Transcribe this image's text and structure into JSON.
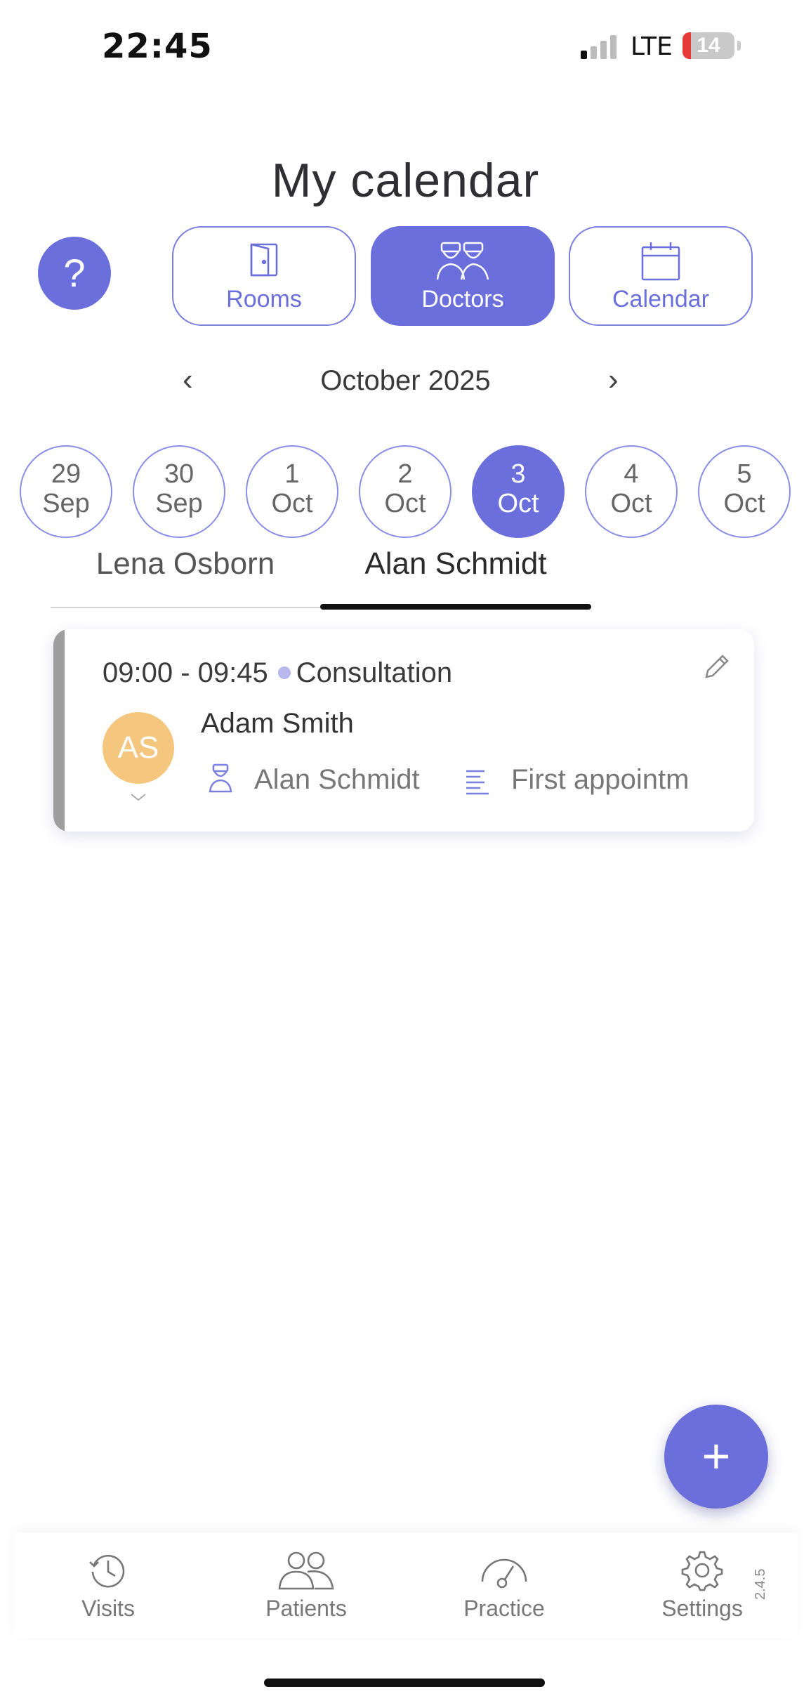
{
  "status_bar": {
    "time": "22:45",
    "network": "LTE",
    "battery": "14"
  },
  "header": {
    "title": "My calendar",
    "help_label": "?"
  },
  "view_switch": [
    {
      "label": "Rooms",
      "icon": "door-icon",
      "active": false
    },
    {
      "label": "Doctors",
      "icon": "doctors-icon",
      "active": true
    },
    {
      "label": "Calendar",
      "icon": "calendar-icon",
      "active": false
    }
  ],
  "month_nav": {
    "prev": "‹",
    "label": "October 2025",
    "next": "›"
  },
  "days": [
    {
      "day": "29",
      "month": "Sep",
      "active": false
    },
    {
      "day": "30",
      "month": "Sep",
      "active": false
    },
    {
      "day": "1",
      "month": "Oct",
      "active": false
    },
    {
      "day": "2",
      "month": "Oct",
      "active": false
    },
    {
      "day": "3",
      "month": "Oct",
      "active": true
    },
    {
      "day": "4",
      "month": "Oct",
      "active": false
    },
    {
      "day": "5",
      "month": "Oct",
      "active": false
    }
  ],
  "doctor_tabs": [
    {
      "label": "Lena Osborn",
      "active": false
    },
    {
      "label": "Alan Schmidt",
      "active": true
    }
  ],
  "appointment": {
    "time": "09:00 - 09:45",
    "type": "Consultation",
    "patient_initials": "AS",
    "patient_name": "Adam Smith",
    "doctor": "Alan Schmidt",
    "notes": "First appointm",
    "colors": {
      "bar": "#9e9e9e",
      "avatar": "#f5c67d",
      "type_dot": "#b7b9ec"
    }
  },
  "fab_label": "+",
  "bottom_nav": [
    {
      "label": "Visits",
      "icon": "clock-icon"
    },
    {
      "label": "Patients",
      "icon": "people-icon"
    },
    {
      "label": "Practice",
      "icon": "gauge-icon"
    },
    {
      "label": "Settings",
      "icon": "gear-icon"
    }
  ],
  "version": "2.4.5",
  "colors": {
    "accent": "#6b6fdc",
    "text": "#333333"
  }
}
